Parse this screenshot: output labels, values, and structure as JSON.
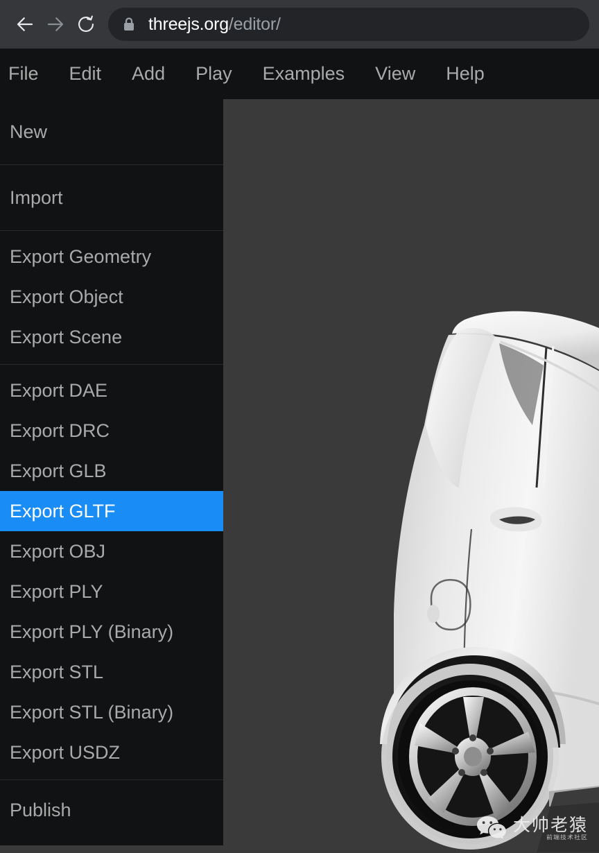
{
  "browser": {
    "back_icon": "arrow-left-icon",
    "forward_icon": "arrow-right-icon",
    "reload_icon": "reload-icon",
    "lock_icon": "lock-icon",
    "url_host": "threejs.org",
    "url_path": "/editor/",
    "chrome_bg": "#35373a",
    "omnibox_bg": "#222427"
  },
  "menubar": {
    "items": [
      {
        "label": "File"
      },
      {
        "label": "Edit"
      },
      {
        "label": "Add"
      },
      {
        "label": "Play"
      },
      {
        "label": "Examples"
      },
      {
        "label": "View"
      },
      {
        "label": "Help"
      }
    ]
  },
  "dropdown": {
    "open_menu": "File",
    "highlight_color": "#1a8cf5",
    "groups": [
      {
        "items": [
          {
            "label": "New",
            "highlighted": false
          }
        ]
      },
      {
        "items": [
          {
            "label": "Import",
            "highlighted": false
          }
        ]
      },
      {
        "items": [
          {
            "label": "Export Geometry",
            "highlighted": false
          },
          {
            "label": "Export Object",
            "highlighted": false
          },
          {
            "label": "Export Scene",
            "highlighted": false
          }
        ]
      },
      {
        "items": [
          {
            "label": "Export DAE",
            "highlighted": false
          },
          {
            "label": "Export DRC",
            "highlighted": false
          },
          {
            "label": "Export GLB",
            "highlighted": false
          },
          {
            "label": "Export GLTF",
            "highlighted": true
          },
          {
            "label": "Export OBJ",
            "highlighted": false
          },
          {
            "label": "Export PLY",
            "highlighted": false
          },
          {
            "label": "Export PLY (Binary)",
            "highlighted": false
          },
          {
            "label": "Export STL",
            "highlighted": false
          },
          {
            "label": "Export STL (Binary)",
            "highlighted": false
          },
          {
            "label": "Export USDZ",
            "highlighted": false
          }
        ]
      },
      {
        "items": [
          {
            "label": "Publish",
            "highlighted": false
          }
        ]
      }
    ]
  },
  "viewport": {
    "background_color": "#3a3a3a",
    "model": "white-car-3d-model"
  },
  "watermark": {
    "logo": "wechat-icon",
    "title": "大帅老猿",
    "subtitle": "前端技术社区"
  }
}
